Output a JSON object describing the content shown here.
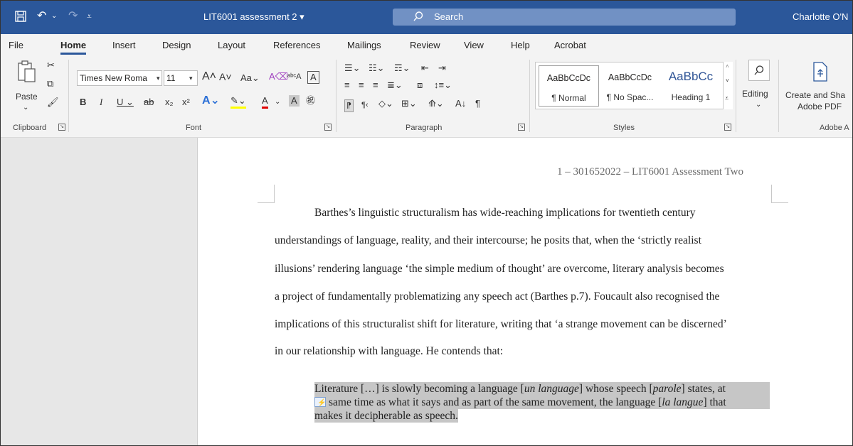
{
  "titlebar": {
    "doc_title": "LIT6001 assessment 2 ▾",
    "search_placeholder": "Search",
    "user": "Charlotte O'N"
  },
  "tabs": [
    "File",
    "Home",
    "Insert",
    "Design",
    "Layout",
    "References",
    "Mailings",
    "Review",
    "View",
    "Help",
    "Acrobat"
  ],
  "ribbon": {
    "clipboard": {
      "paste": "Paste",
      "label": "Clipboard"
    },
    "font": {
      "name": "Times New Roma",
      "size": "11",
      "label": "Font"
    },
    "paragraph": {
      "label": "Paragraph"
    },
    "styles": {
      "label": "Styles",
      "items": [
        {
          "sample": "AaBbCcDc",
          "name": "¶ Normal"
        },
        {
          "sample": "AaBbCcDc",
          "name": "¶ No Spac..."
        },
        {
          "sample": "AaBbCc",
          "name": "Heading 1"
        }
      ]
    },
    "editing": {
      "label": "Editing"
    },
    "adobe": {
      "line1": "Create and Sha",
      "line2": "Adobe PDF",
      "label": "Adobe A"
    }
  },
  "document": {
    "header": "1 – 301652022 – LIT6001 Assessment Two",
    "paragraph_lines": [
      "Barthes’s linguistic structuralism has wide-reaching implications for twentieth century",
      "understandings of language, reality, and their intercourse; he posits that, when the ‘strictly realist",
      "illusions’ rendering language ‘the simple medium of thought’ are overcome, literary analysis becomes",
      "a project of fundamentally problematizing any speech act (Barthes p.7). Foucault also recognised the",
      "implications of this structuralist shift for literature, writing that ‘a strange movement can be discerned’",
      "in our relationship with language. He contends that:"
    ],
    "quote": {
      "l1_a": "Literature […] is slowly becoming a language [",
      "l1_b": "un language",
      "l1_c": "] whose speech [",
      "l1_d": "parole",
      "l1_e": "] states, at",
      "l2_a": "same time as what it says and as part of the same movement, the language [",
      "l2_b": "la langue",
      "l2_c": "] that",
      "l3": "makes it decipherable as speech."
    }
  },
  "colors": {
    "titlebar": "#2b579a",
    "search": "#7191c4",
    "highlight": "#c6c6c6"
  }
}
